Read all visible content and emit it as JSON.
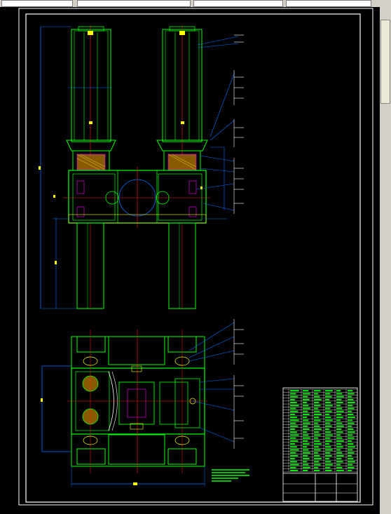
{
  "app": {
    "window_title": "",
    "toolbar_labels": [
      "",
      "",
      "",
      "",
      "",
      ""
    ]
  },
  "drawing": {
    "title_block": {
      "drawing_name": "",
      "scale": "",
      "sheet": ""
    },
    "colors": {
      "background": "#000000",
      "frame": "#ffffff",
      "body": "#00ff00",
      "dimension": "#0070ff",
      "center": "#ff2020",
      "hatch": "#ffff00",
      "detail": "#ff00ff"
    }
  }
}
